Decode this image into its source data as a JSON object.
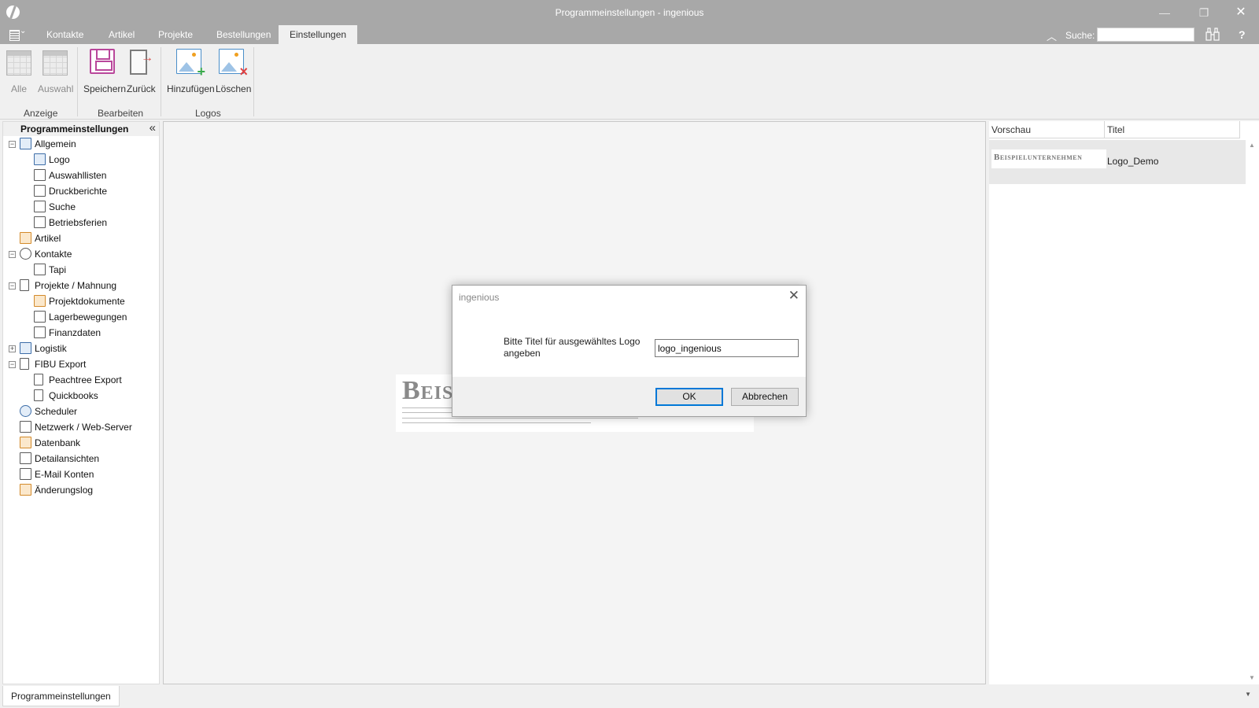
{
  "window": {
    "title": "Programmeinstellungen - ingenious",
    "min_glyph": "—",
    "max_glyph": "❐",
    "close_glyph": "✕"
  },
  "ribbon_tabs": [
    "Kontakte",
    "Artikel",
    "Projekte",
    "Bestellungen",
    "Einstellungen"
  ],
  "active_tab": "Einstellungen",
  "search": {
    "label": "Suche:",
    "value": ""
  },
  "help_glyph": "?",
  "ribbon": {
    "groups": [
      {
        "label": "Anzeige",
        "buttons": [
          {
            "label": "Alle",
            "icon": "table-icon",
            "enabled": false
          },
          {
            "label": "Auswahl",
            "icon": "table-icon",
            "enabled": false
          }
        ]
      },
      {
        "label": "Bearbeiten",
        "buttons": [
          {
            "label": "Speichern",
            "icon": "save-icon",
            "enabled": true
          },
          {
            "label": "Zurück",
            "icon": "exit-icon",
            "enabled": true
          }
        ]
      },
      {
        "label": "Logos",
        "buttons": [
          {
            "label": "Hinzufügen",
            "icon": "image-add-icon",
            "enabled": true
          },
          {
            "label": "Löschen",
            "icon": "image-delete-icon",
            "enabled": true
          }
        ]
      }
    ]
  },
  "nav": {
    "title": "Programmeinstellungen",
    "collapse_glyph": "«",
    "items": [
      {
        "label": "Allgemein",
        "level": 0,
        "expander": "−",
        "icon": "contact-card-icon"
      },
      {
        "label": "Logo",
        "level": 1,
        "icon": "image-icon"
      },
      {
        "label": "Auswahllisten",
        "level": 1,
        "icon": "list-icon"
      },
      {
        "label": "Druckberichte",
        "level": 1,
        "icon": "printer-icon"
      },
      {
        "label": "Suche",
        "level": 1,
        "icon": "binoculars-icon"
      },
      {
        "label": "Betriebsferien",
        "level": 1,
        "icon": "airplane-icon"
      },
      {
        "label": "Artikel",
        "level": 0,
        "icon": "box-icon"
      },
      {
        "label": "Kontakte",
        "level": 0,
        "expander": "−",
        "icon": "person-icon"
      },
      {
        "label": "Tapi",
        "level": 1,
        "icon": "phone-icon"
      },
      {
        "label": "Projekte / Mahnung",
        "level": 0,
        "expander": "−",
        "icon": "document-icon"
      },
      {
        "label": "Projektdokumente",
        "level": 1,
        "icon": "document-list-icon"
      },
      {
        "label": "Lagerbewegungen",
        "level": 1,
        "icon": "calculator-icon"
      },
      {
        "label": "Finanzdaten",
        "level": 1,
        "icon": "bank-icon"
      },
      {
        "label": "Logistik",
        "level": 0,
        "expander": "+",
        "icon": "truck-icon"
      },
      {
        "label": "FIBU Export",
        "level": 0,
        "expander": "−",
        "icon": "export-icon"
      },
      {
        "label": "Peachtree Export",
        "level": 1,
        "icon": "export-icon"
      },
      {
        "label": "Quickbooks",
        "level": 1,
        "icon": "export-icon"
      },
      {
        "label": "Scheduler",
        "level": 0,
        "icon": "clock-icon"
      },
      {
        "label": "Netzwerk / Web-Server",
        "level": 0,
        "icon": "network-icon"
      },
      {
        "label": "Datenbank",
        "level": 0,
        "icon": "database-icon"
      },
      {
        "label": "Detailansichten",
        "level": 0,
        "icon": "table-view-icon"
      },
      {
        "label": "E-Mail Konten",
        "level": 0,
        "icon": "email-icon"
      },
      {
        "label": "Änderungslog",
        "level": 0,
        "icon": "change-log-icon"
      }
    ]
  },
  "preview_logo_text": "Beispielunternehmen",
  "logo_list": {
    "columns": [
      "Vorschau",
      "Titel"
    ],
    "rows": [
      {
        "preview_text": "Beispielunternehmen",
        "title": "Logo_Demo"
      }
    ]
  },
  "statusbar": {
    "tab_label": "Programmeinstellungen",
    "arrow": "▼"
  },
  "dialog": {
    "title": "ingenious",
    "close_glyph": "✕",
    "prompt": "Bitte Titel für ausgewähltes Logo angeben",
    "input_value": "logo_ingenious",
    "ok_label": "OK",
    "cancel_label": "Abbrechen"
  }
}
